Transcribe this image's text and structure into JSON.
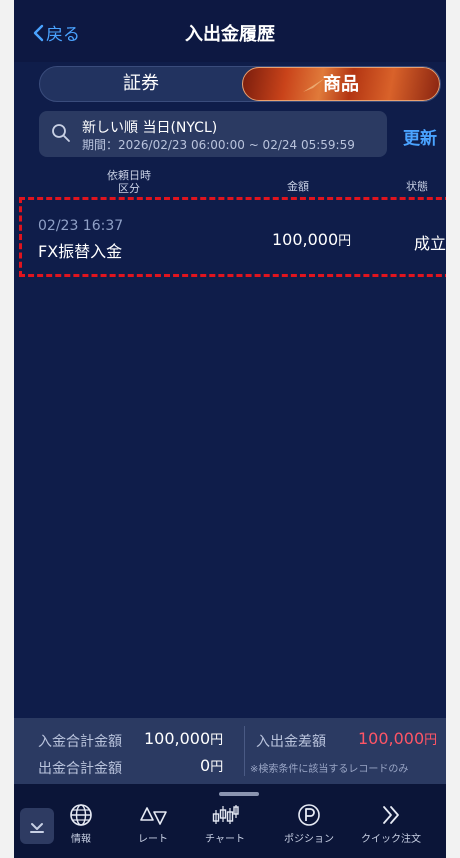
{
  "header": {
    "back_label": "戻る",
    "title": "入出金履歴"
  },
  "segments": {
    "left": "証券",
    "right": "商品"
  },
  "search": {
    "line1": "新しい順 当日(NYCL)",
    "line2": "期間：2026/02/23 06:00:00 ~ 02/24 05:59:59"
  },
  "refresh_label": "更新",
  "columns": {
    "datetime": "依頼日時",
    "category": "区分",
    "amount": "金額",
    "status": "状態"
  },
  "rows": [
    {
      "date": "02/23 16:37",
      "type": "FX振替入金",
      "amount": "100,000",
      "currency": "円",
      "status": "成立"
    }
  ],
  "summary": {
    "deposit_label": "入金合計金額",
    "deposit_value": "100,000",
    "deposit_unit": "円",
    "withdraw_label": "出金合計金額",
    "withdraw_value": "0",
    "withdraw_unit": "円",
    "diff_label": "入出金差額",
    "diff_value": "100,000",
    "diff_unit": "円",
    "note": "※検索条件に該当するレコードのみ"
  },
  "tabs": [
    {
      "label": "情報",
      "icon": "globe-icon"
    },
    {
      "label": "レート",
      "icon": "rate-icon"
    },
    {
      "label": "チャート",
      "icon": "chart-candle-icon"
    },
    {
      "label": "ポジション",
      "icon": "position-icon"
    },
    {
      "label": "クイック注文",
      "icon": "double-chevron-icon"
    }
  ],
  "colors": {
    "accent": "#4aa3ff",
    "background": "#0f1d4a",
    "negative_red": "#ff5566",
    "highlight_border": "#e0141e"
  }
}
